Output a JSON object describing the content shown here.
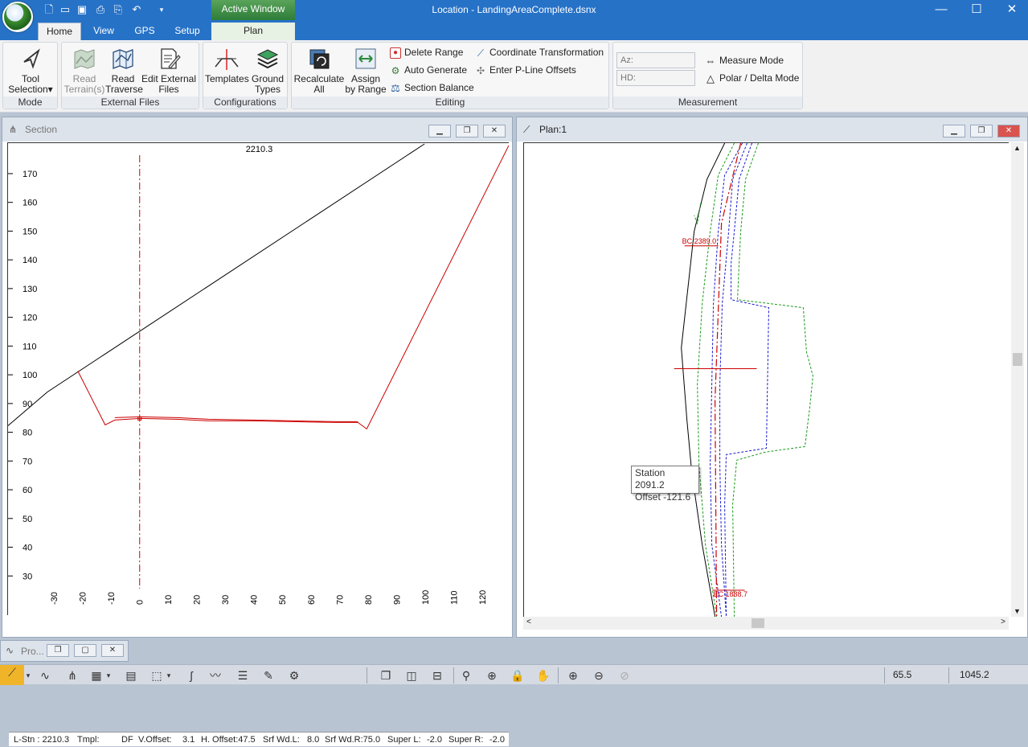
{
  "window": {
    "title": "Location - LandingAreaComplete.dsnx",
    "active_window_label": "Active Window",
    "context_tab": "Plan"
  },
  "tabs": [
    "Home",
    "View",
    "GPS",
    "Setup"
  ],
  "ribbon": {
    "mode": {
      "label": "Mode",
      "tool_selection": "Tool Selection",
      "tool_selection_arrow": "▾"
    },
    "external_files": {
      "label": "External Files",
      "read_terrains": "Read Terrain(s)",
      "read_traverse": "Read Traverse",
      "edit_external_files": "Edit External Files"
    },
    "configurations": {
      "label": "Configurations",
      "templates": "Templates",
      "ground_types": "Ground Types"
    },
    "editing": {
      "label": "Editing",
      "recalculate_all": "Recalculate All",
      "assign_by_range": "Assign by Range",
      "delete_range": "Delete Range",
      "auto_generate": "Auto Generate",
      "section_balance": "Section Balance",
      "coordinate_transformation": "Coordinate Transformation",
      "enter_pline_offsets": "Enter P-Line Offsets"
    },
    "measurement": {
      "label": "Measurement",
      "az_placeholder": "Az:",
      "hd_placeholder": "HD:",
      "measure_mode": "Measure Mode",
      "polar_delta_mode": "Polar / Delta Mode"
    }
  },
  "section": {
    "title": "Section",
    "station_label": "2210.3",
    "y_ticks": [
      "170",
      "160",
      "150",
      "140",
      "130",
      "120",
      "110",
      "100",
      "90",
      "80",
      "70",
      "60",
      "50",
      "40",
      "30"
    ],
    "x_ticks": [
      "-30",
      "-20",
      "-10",
      "0",
      "10",
      "20",
      "30",
      "40",
      "50",
      "60",
      "70",
      "80",
      "90",
      "100",
      "110",
      "120"
    ],
    "footer": {
      "l_stn": "L-Stn : 2210.3",
      "tmpl": "Tmpl:",
      "df": "DF",
      "v_offset": "V.Offset:",
      "v_offset_val": "3.1",
      "h_offset": "H. Offset:47.5",
      "srf_wd_l": "Srf Wd.L:",
      "srf_wd_l_val": "8.0",
      "srf_wd_r": "Srf Wd.R:75.0",
      "super_l": "Super L:",
      "super_l_val": "-2.0",
      "super_r": "Super R:",
      "super_r_val": "-2.0"
    }
  },
  "plan": {
    "title": "Plan:1",
    "bc_label": "BC 2389.0",
    "ec_label": "EC 1888.7",
    "tooltip": {
      "station": "Station 2091.2",
      "offset": "Offset -121.6"
    }
  },
  "profile_min": {
    "title": "Pro..."
  },
  "statusbar": {
    "value1": "65.5",
    "value2": "1045.2"
  },
  "colors": {
    "title_blue": "#2672c7",
    "ground_line": "#000000",
    "design_line": "#cc0000",
    "centerline": "#cc0000",
    "offset_blue": "#1a1acc",
    "offset_green": "#1a9a1a"
  }
}
